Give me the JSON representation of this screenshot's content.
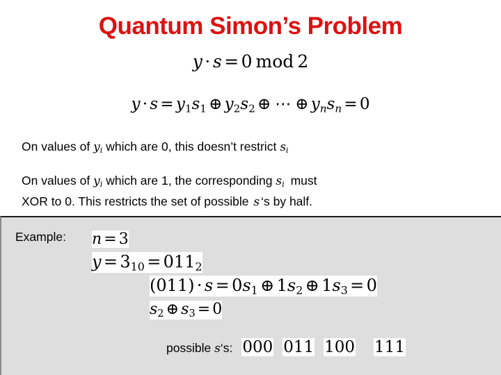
{
  "slide": {
    "title": "Quantum Simon’s Problem",
    "title_color": "#dd1111",
    "background": "#ffffff"
  },
  "equations": {
    "mod2": {
      "y": "y",
      "dot": "·",
      "s": "s",
      "equals": "=",
      "zero": "0",
      "mod": "mod",
      "two": "2",
      "plain": "y · s = 0 mod 2"
    },
    "expanded": {
      "plain": "y · s = y1s1 ⊕ y2s2 ⊕ ⋯ ⊕ ynsn = 0",
      "lhs_y": "y",
      "dot": "·",
      "lhs_s": "s",
      "equals": "=",
      "term1_y": "y",
      "term1_y_sub": "1",
      "term1_s": "s",
      "term1_s_sub": "1",
      "xor": "⊕",
      "term2_y": "y",
      "term2_y_sub": "2",
      "term2_s": "s",
      "term2_s_sub": "2",
      "ellipsis": "⋯",
      "termn_y": "y",
      "termn_y_sub": "n",
      "termn_s": "s",
      "termn_s_sub": "n",
      "result": "0"
    }
  },
  "prose": {
    "zero_case": {
      "part1": "On values of",
      "var_y": "y",
      "var_y_sub": "i",
      "part2": "which are 0, this doesn’t restrict",
      "var_s": "s",
      "var_s_sub": "i",
      "plain": "On values of yi which are 0, this doesn’t restrict si"
    },
    "one_case": {
      "part1": "On values of",
      "var_y": "y",
      "var_y_sub": "i",
      "part2": "which are 1, the corresponding",
      "var_s": "s",
      "var_s_sub": "i",
      "part3": "must",
      "line2_part1": "XOR to 0.   This restricts the set of possible",
      "line2_var_s": "s",
      "line2_part2": "‘s by half.",
      "plain": "On values of yi which are 1, the corresponding si must XOR to 0.   This restricts the set of possible s‘s by half."
    }
  },
  "example": {
    "panel_background": "#dedede",
    "label": "Example:",
    "eq_n": {
      "n": "n",
      "equals": "=",
      "value": "3",
      "plain": "n = 3"
    },
    "eq_y": {
      "y": "y",
      "equals": "=",
      "decimal": "3",
      "decimal_sub": "10",
      "equals2": "=",
      "binary": "011",
      "binary_sub": "2",
      "plain": "y = 3_10 = 011_2"
    },
    "eq_dot": {
      "vector": "(011)",
      "dot": "·",
      "s": "s",
      "equals": "=",
      "t1_coef": "0",
      "t1_s": "s",
      "t1_sub": "1",
      "xor": "⊕",
      "t2_coef": "1",
      "t2_s": "s",
      "t2_sub": "2",
      "t3_coef": "1",
      "t3_s": "s",
      "t3_sub": "3",
      "result": "0",
      "plain": "(011) · s = 0s1 ⊕ 1s2 ⊕ 1s3 = 0"
    },
    "eq_s2s3": {
      "s_a": "s",
      "s_a_sub": "2",
      "xor": "⊕",
      "s_b": "s",
      "s_b_sub": "3",
      "equals": "=",
      "result": "0",
      "plain": "s2 ⊕ s3 = 0"
    },
    "possible": {
      "label_prefix": "possible",
      "var_s": "s",
      "label_suffix": "‘s:",
      "values": [
        "000",
        "011",
        "100",
        "111"
      ]
    }
  }
}
